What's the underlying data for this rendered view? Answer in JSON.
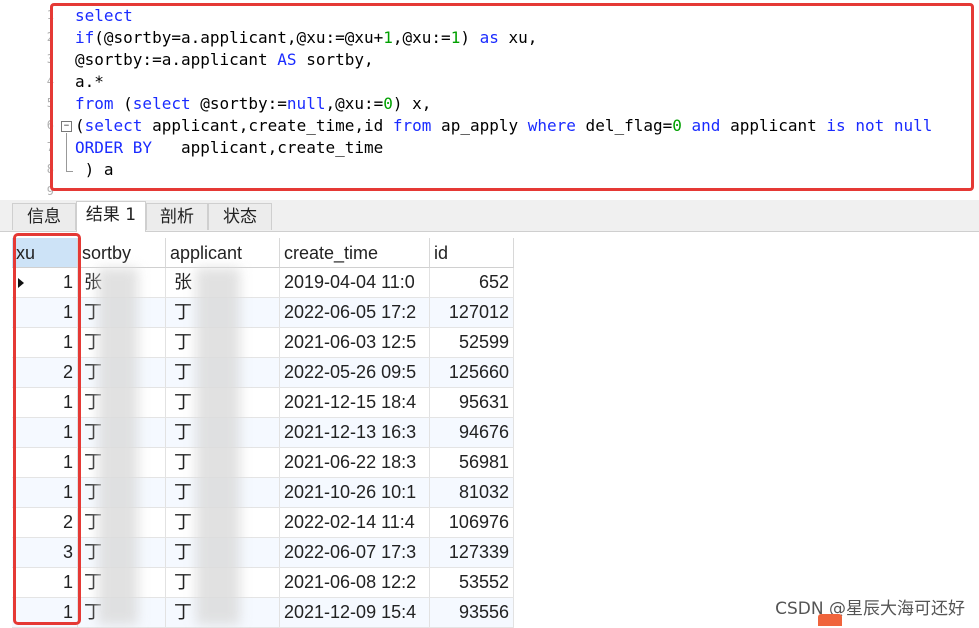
{
  "editor": {
    "line_numbers": [
      "1",
      "2",
      "3",
      "4",
      "5",
      "6",
      "7",
      "8",
      "9"
    ],
    "lines": [
      [
        {
          "t": "select",
          "c": "kw"
        }
      ],
      [
        {
          "t": "if",
          "c": "kw"
        },
        {
          "t": "(@sortby=a.applicant,@xu:=@xu+",
          "c": "sym"
        },
        {
          "t": "1",
          "c": "num"
        },
        {
          "t": ",@xu:=",
          "c": "sym"
        },
        {
          "t": "1",
          "c": "num"
        },
        {
          "t": ") ",
          "c": "sym"
        },
        {
          "t": "as",
          "c": "kw"
        },
        {
          "t": " xu,",
          "c": "sym"
        }
      ],
      [
        {
          "t": "@sortby:=a.applicant ",
          "c": "sym"
        },
        {
          "t": "AS",
          "c": "kw"
        },
        {
          "t": " sortby,",
          "c": "sym"
        }
      ],
      [
        {
          "t": "a.*",
          "c": "sym"
        }
      ],
      [
        {
          "t": "from",
          "c": "kw"
        },
        {
          "t": " (",
          "c": "sym"
        },
        {
          "t": "select",
          "c": "kw"
        },
        {
          "t": " @sortby:=",
          "c": "sym"
        },
        {
          "t": "null",
          "c": "kw"
        },
        {
          "t": ",@xu:=",
          "c": "sym"
        },
        {
          "t": "0",
          "c": "num"
        },
        {
          "t": ") x,",
          "c": "sym"
        }
      ],
      [
        {
          "t": "(",
          "c": "sym"
        },
        {
          "t": "select",
          "c": "kw"
        },
        {
          "t": " applicant,create_time,id ",
          "c": "sym"
        },
        {
          "t": "from",
          "c": "kw"
        },
        {
          "t": " ap_apply ",
          "c": "sym"
        },
        {
          "t": "where",
          "c": "kw"
        },
        {
          "t": " del_flag=",
          "c": "sym"
        },
        {
          "t": "0",
          "c": "num"
        },
        {
          "t": " ",
          "c": "sym"
        },
        {
          "t": "and",
          "c": "kw"
        },
        {
          "t": " applicant ",
          "c": "sym"
        },
        {
          "t": "is",
          "c": "kw"
        },
        {
          "t": " ",
          "c": "sym"
        },
        {
          "t": "not",
          "c": "kw"
        },
        {
          "t": " ",
          "c": "sym"
        },
        {
          "t": "null",
          "c": "kw"
        }
      ],
      [
        {
          "t": "ORDER BY",
          "c": "kw"
        },
        {
          "t": "   applicant,create_time",
          "c": "sym"
        }
      ],
      [
        {
          "t": " ) a",
          "c": "sym"
        }
      ]
    ]
  },
  "tabs": [
    {
      "label": "信息",
      "active": false
    },
    {
      "label": "结果 1",
      "active": true
    },
    {
      "label": "剖析",
      "active": false
    },
    {
      "label": "状态",
      "active": false
    }
  ],
  "grid": {
    "columns": [
      "xu",
      "sortby",
      "applicant",
      "create_time",
      "id"
    ],
    "rows": [
      {
        "xu": "1",
        "sortby": "张",
        "applicant": "张",
        "create_time": "2019-04-04 11:0",
        "id": "652"
      },
      {
        "xu": "1",
        "sortby": "丁",
        "applicant": "丁",
        "create_time": "2022-06-05 17:2",
        "id": "127012"
      },
      {
        "xu": "1",
        "sortby": "丁",
        "applicant": "丁",
        "create_time": "2021-06-03 12:5",
        "id": "52599"
      },
      {
        "xu": "2",
        "sortby": "丁",
        "applicant": "丁",
        "create_time": "2022-05-26 09:5",
        "id": "125660"
      },
      {
        "xu": "1",
        "sortby": "丁",
        "applicant": "丁",
        "create_time": "2021-12-15 18:4",
        "id": "95631"
      },
      {
        "xu": "1",
        "sortby": "丁",
        "applicant": "丁",
        "create_time": "2021-12-13 16:3",
        "id": "94676"
      },
      {
        "xu": "1",
        "sortby": "丁",
        "applicant": "丁",
        "create_time": "2021-06-22 18:3",
        "id": "56981"
      },
      {
        "xu": "1",
        "sortby": "丁",
        "applicant": "丁",
        "create_time": "2021-10-26 10:1",
        "id": "81032"
      },
      {
        "xu": "2",
        "sortby": "丁",
        "applicant": "丁",
        "create_time": "2022-02-14 11:4",
        "id": "106976"
      },
      {
        "xu": "3",
        "sortby": "丁",
        "applicant": "丁",
        "create_time": "2022-06-07 17:3",
        "id": "127339"
      },
      {
        "xu": "1",
        "sortby": "丁",
        "applicant": "丁",
        "create_time": "2021-06-08 12:2",
        "id": "53552"
      },
      {
        "xu": "1",
        "sortby": "丁",
        "applicant": "丁",
        "create_time": "2021-12-09 15:4",
        "id": "93556"
      }
    ]
  },
  "watermark": "CSDN @星辰大海可还好",
  "colors": {
    "highlight_box": "#e53935",
    "keyword": "#1a2bff",
    "number": "#00a000",
    "selected_header": "#cde3f7"
  }
}
